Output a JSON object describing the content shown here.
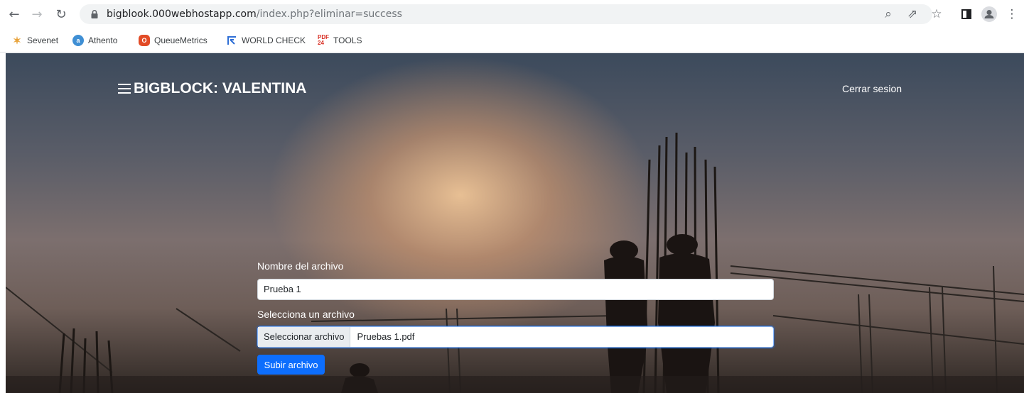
{
  "browser": {
    "url_host": "bigblook.000webhostapp.com",
    "url_path": "/index.php?eliminar=success"
  },
  "bookmarks": [
    {
      "label": "Sevenet",
      "icon": "sevenet-icon",
      "color": "#e8a33b"
    },
    {
      "label": "Athento",
      "icon": "athento-icon",
      "color": "#3f8fd4"
    },
    {
      "label": "QueueMetrics",
      "icon": "queuemetrics-icon",
      "color": "#e24b26"
    },
    {
      "label": "WORLD CHECK",
      "icon": "worldcheck-icon",
      "color": "#2f6fd6"
    },
    {
      "label": "TOOLS",
      "icon": "pdf-tools-icon",
      "color": "#d93025"
    }
  ],
  "navbar": {
    "brand": "BIGBLOCK: VALENTINA",
    "logout_label": "Cerrar sesion"
  },
  "form": {
    "name_label": "Nombre del archivo",
    "name_value": "Prueba 1",
    "file_label": "Selecciona un archivo",
    "file_button": "Seleccionar archivo",
    "file_name": "Pruebas 1.pdf",
    "submit_label": "Subir archivo"
  },
  "colors": {
    "primary": "#0d6efd",
    "text_light": "#ffffff"
  }
}
